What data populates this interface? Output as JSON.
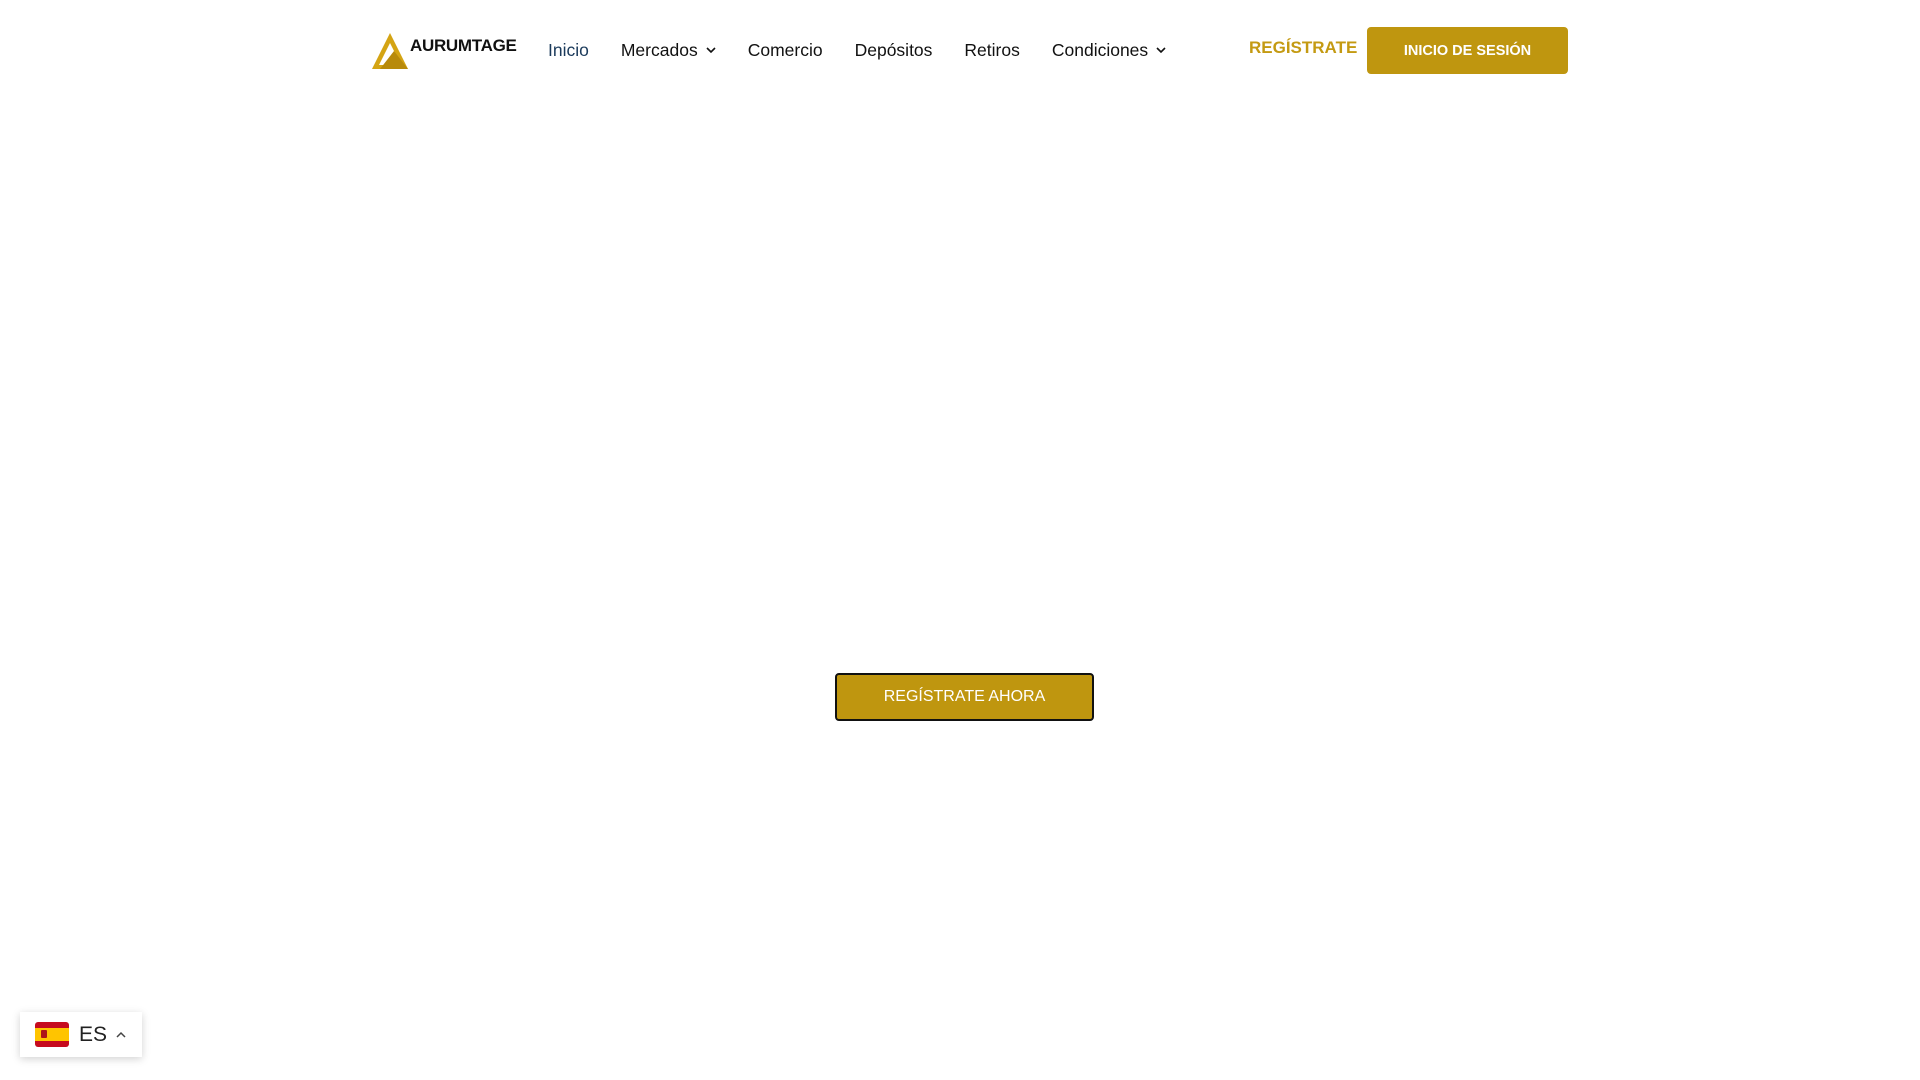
{
  "brand": {
    "name": "AURUMTAGE",
    "accent": "#bf960f",
    "logo_icon": "triangle-logo-icon"
  },
  "nav": {
    "items": [
      {
        "label": "Inicio",
        "active": true
      },
      {
        "label": "Mercados",
        "dropdown": true
      },
      {
        "label": "Comercio"
      },
      {
        "label": "Depósitos"
      },
      {
        "label": "Retiros"
      },
      {
        "label": "Condiciones",
        "dropdown": true
      }
    ]
  },
  "header": {
    "signup_label": "REGÍSTRATE",
    "login_label": "INICIO DE SESIÓN"
  },
  "hero": {
    "cta_label": "REGÍSTRATE AHORA"
  },
  "language": {
    "code": "ES",
    "flag": "spain-flag-icon",
    "caret": "chevron-up-icon"
  }
}
